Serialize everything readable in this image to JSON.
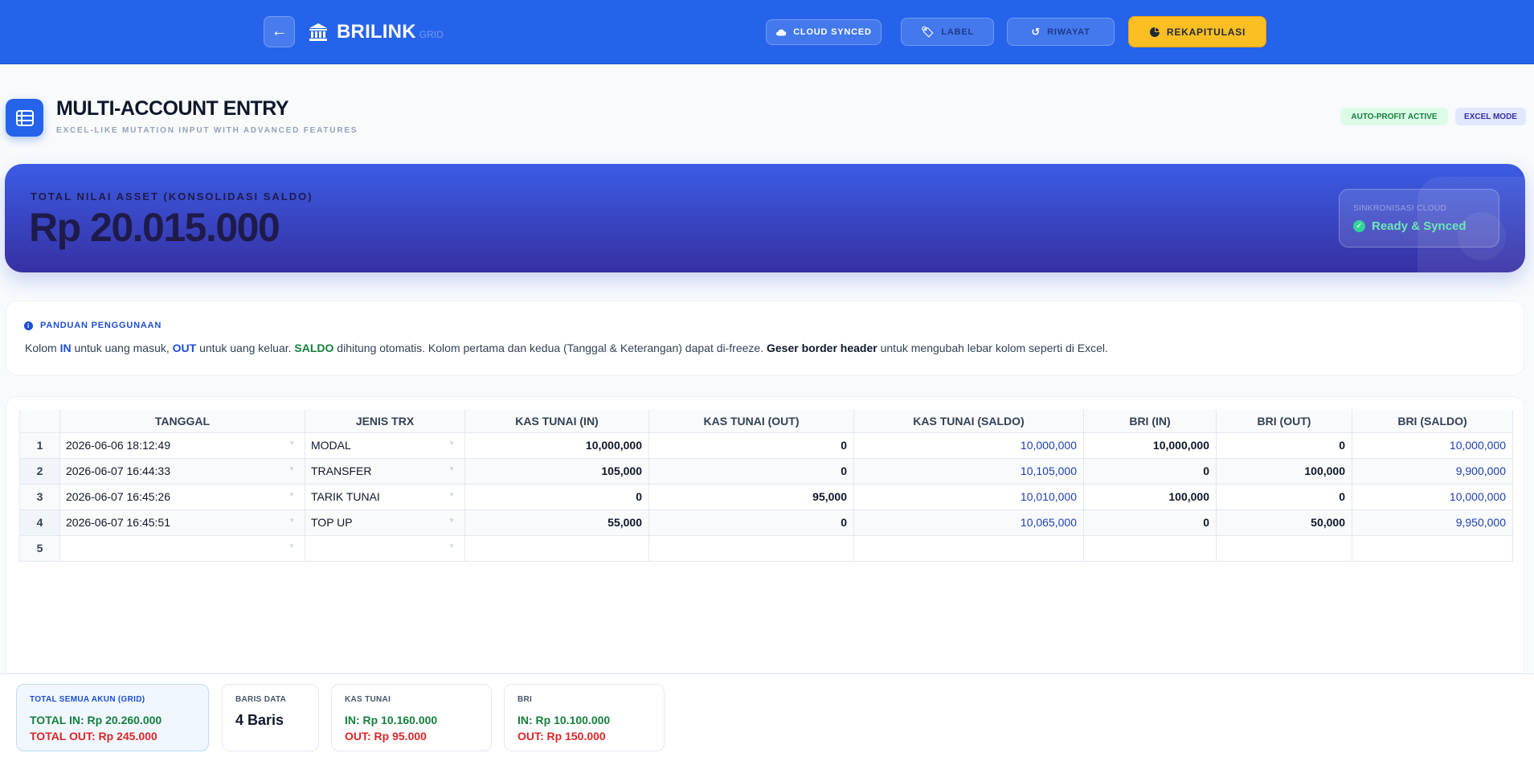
{
  "header": {
    "brand": "BRILINK",
    "brand_sub": "GRID",
    "cloud_synced": "CLOUD SYNCED",
    "label_btn": "LABEL",
    "riwayat_btn": "RIWAYAT",
    "rekap_btn": "REKAPITULASI"
  },
  "page": {
    "title": "MULTI-ACCOUNT ENTRY",
    "subtitle": "EXCEL-LIKE MUTATION INPUT WITH ADVANCED FEATURES",
    "badge_profit": "AUTO-PROFIT ACTIVE",
    "badge_excel": "EXCEL MODE"
  },
  "asset": {
    "label": "TOTAL NILAI ASSET (KONSOLIDASI SALDO)",
    "value": "Rp 20.015.000",
    "sync_label": "SINKRONISASI CLOUD",
    "sync_status": "Ready & Synced"
  },
  "guide": {
    "title": "PANDUAN PENGGUNAAN",
    "t1": "Kolom ",
    "in": "IN",
    "t2": " untuk uang masuk, ",
    "out": "OUT",
    "t3": " untuk uang keluar. ",
    "saldo": "SALDO",
    "t4": " dihitung otomatis. Kolom pertama dan kedua (Tanggal & Keterangan) dapat di-freeze. ",
    "geser": "Geser border header",
    "t5": " untuk mengubah lebar kolom seperti di Excel."
  },
  "grid": {
    "columns": [
      "TANGGAL",
      "JENIS TRX",
      "KAS TUNAI (IN)",
      "KAS TUNAI (OUT)",
      "KAS TUNAI (SALDO)",
      "BRI (IN)",
      "BRI (OUT)",
      "BRI (SALDO)"
    ],
    "rows": [
      {
        "no": "1",
        "tanggal": "2026-06-06 18:12:49",
        "jenis": "MODAL",
        "kas_in": "10,000,000",
        "kas_out": "0",
        "kas_saldo": "10,000,000",
        "bri_in": "10,000,000",
        "bri_out": "0",
        "bri_saldo": "10,000,000"
      },
      {
        "no": "2",
        "tanggal": "2026-06-07 16:44:33",
        "jenis": "TRANSFER",
        "kas_in": "105,000",
        "kas_out": "0",
        "kas_saldo": "10,105,000",
        "bri_in": "0",
        "bri_out": "100,000",
        "bri_saldo": "9,900,000"
      },
      {
        "no": "3",
        "tanggal": "2026-06-07 16:45:26",
        "jenis": "TARIK TUNAI",
        "kas_in": "0",
        "kas_out": "95,000",
        "kas_saldo": "10,010,000",
        "bri_in": "100,000",
        "bri_out": "0",
        "bri_saldo": "10,000,000"
      },
      {
        "no": "4",
        "tanggal": "2026-06-07 16:45:51",
        "jenis": "TOP UP",
        "kas_in": "55,000",
        "kas_out": "0",
        "kas_saldo": "10,065,000",
        "bri_in": "0",
        "bri_out": "50,000",
        "bri_saldo": "9,950,000"
      },
      {
        "no": "5",
        "tanggal": "",
        "jenis": "",
        "kas_in": "",
        "kas_out": "",
        "kas_saldo": "",
        "bri_in": "",
        "bri_out": "",
        "bri_saldo": ""
      }
    ]
  },
  "summary": {
    "total": {
      "title": "TOTAL SEMUA AKUN (GRID)",
      "in": "TOTAL IN: Rp 20.260.000",
      "out": "TOTAL OUT: Rp 245.000"
    },
    "baris": {
      "title": "BARIS DATA",
      "value": "4 Baris"
    },
    "kas": {
      "title": "KAS TUNAI",
      "in": "IN: Rp 10.160.000",
      "out": "OUT: Rp 95.000"
    },
    "bri": {
      "title": "BRI",
      "in": "IN: Rp 10.100.000",
      "out": "OUT: Rp 150.000"
    }
  }
}
